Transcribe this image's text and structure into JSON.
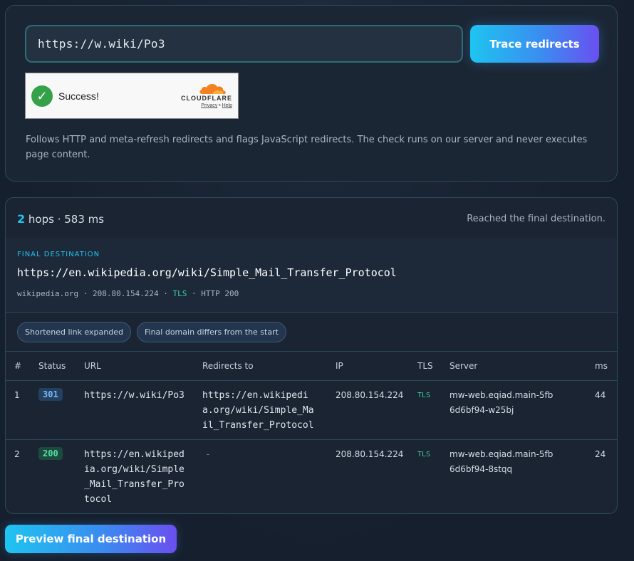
{
  "search": {
    "url_value": "https://w.wiki/Po3",
    "trace_label": "Trace redirects"
  },
  "captcha": {
    "status": "Success!",
    "brand": "CLOUDFLARE",
    "privacy": "Privacy",
    "sep": "•",
    "help": "Help"
  },
  "description": "Follows HTTP and meta-refresh redirects and flags JavaScript redirects. The check runs on our server and never executes page content.",
  "summary": {
    "hops": "2",
    "hops_rest": "hops · 583 ms",
    "reached": "Reached the final destination."
  },
  "final": {
    "label": "FINAL DESTINATION",
    "url": "https://en.wikipedia.org/wiki/Simple_Mail_Transfer_Protocol",
    "meta_prefix": "wikipedia.org · 208.80.154.224 · ",
    "tls": "TLS",
    "meta_suffix": " · HTTP 200"
  },
  "tags": [
    "Shortened link expanded",
    "Final domain differs from the start"
  ],
  "table": {
    "headers": [
      "#",
      "Status",
      "URL",
      "Redirects to",
      "IP",
      "TLS",
      "Server",
      "ms"
    ],
    "rows": [
      {
        "num": "1",
        "status": "301",
        "url": "https://w.wiki/Po3",
        "redirect": "https://en.wikipedia.org/wiki/Simple_Mail_Transfer_Protocol",
        "ip": "208.80.154.224",
        "tls": "TLS",
        "server": "mw-web.eqiad.main-5fb6d6bf94-w25bj",
        "ms": "44"
      },
      {
        "num": "2",
        "status": "200",
        "url": "https://en.wikipedia.org/wiki/Simple_Mail_Transfer_Protocol",
        "redirect": "-",
        "ip": "208.80.154.224",
        "tls": "TLS",
        "server": "mw-web.eqiad.main-5fb6d6bf94-8stqq",
        "ms": "24"
      }
    ]
  },
  "preview_label": "Preview final destination"
}
